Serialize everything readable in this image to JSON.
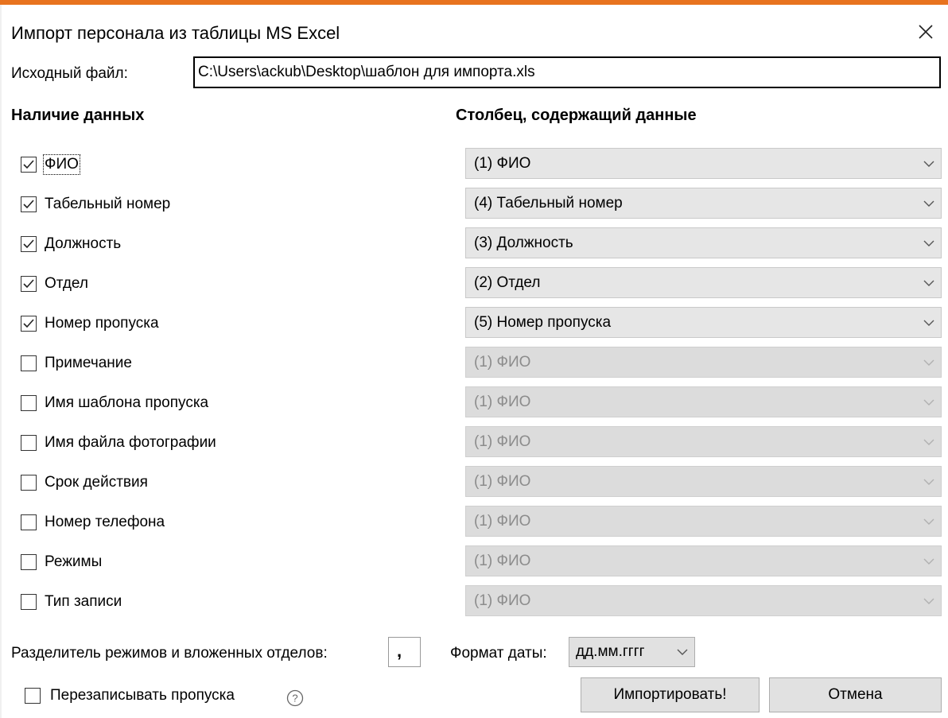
{
  "window": {
    "title": "Импорт персонала из таблицы MS Excel",
    "close_icon": "close-icon"
  },
  "source": {
    "label": "Исходный файл:",
    "value": "C:\\Users\\ackub\\Desktop\\шаблон для импорта.xls"
  },
  "headers": {
    "left": "Наличие данных",
    "right": "Столбец, содержащий данные"
  },
  "fields": [
    {
      "label": "ФИО",
      "checked": true,
      "column": "(1) ФИО",
      "enabled": true
    },
    {
      "label": "Табельный номер",
      "checked": true,
      "column": "(4) Табельный номер",
      "enabled": true
    },
    {
      "label": "Должность",
      "checked": true,
      "column": "(3) Должность",
      "enabled": true
    },
    {
      "label": "Отдел",
      "checked": true,
      "column": "(2) Отдел",
      "enabled": true
    },
    {
      "label": "Номер пропуска",
      "checked": true,
      "column": "(5) Номер пропуска",
      "enabled": true
    },
    {
      "label": "Примечание",
      "checked": false,
      "column": "(1) ФИО",
      "enabled": false
    },
    {
      "label": "Имя шаблона пропуска",
      "checked": false,
      "column": "(1) ФИО",
      "enabled": false
    },
    {
      "label": "Имя файла фотографии",
      "checked": false,
      "column": "(1) ФИО",
      "enabled": false
    },
    {
      "label": "Срок действия",
      "checked": false,
      "column": "(1) ФИО",
      "enabled": false
    },
    {
      "label": "Номер телефона",
      "checked": false,
      "column": "(1) ФИО",
      "enabled": false
    },
    {
      "label": "Режимы",
      "checked": false,
      "column": "(1) ФИО",
      "enabled": false
    },
    {
      "label": "Тип записи",
      "checked": false,
      "column": "(1) ФИО",
      "enabled": false
    }
  ],
  "separator": {
    "label": "Разделитель режимов и вложенных отделов:",
    "value": ","
  },
  "date_format": {
    "label": "Формат даты:",
    "value": "дд.мм.гггг"
  },
  "overwrite": {
    "label": "Перезаписывать пропуска",
    "checked": false,
    "help_icon": "help-icon"
  },
  "buttons": {
    "import": "Импортировать!",
    "cancel": "Отмена"
  },
  "colors": {
    "accent_bar": "#e8731f",
    "combo_bg": "#e6e6e6",
    "disabled_text": "#8c8c8c"
  }
}
